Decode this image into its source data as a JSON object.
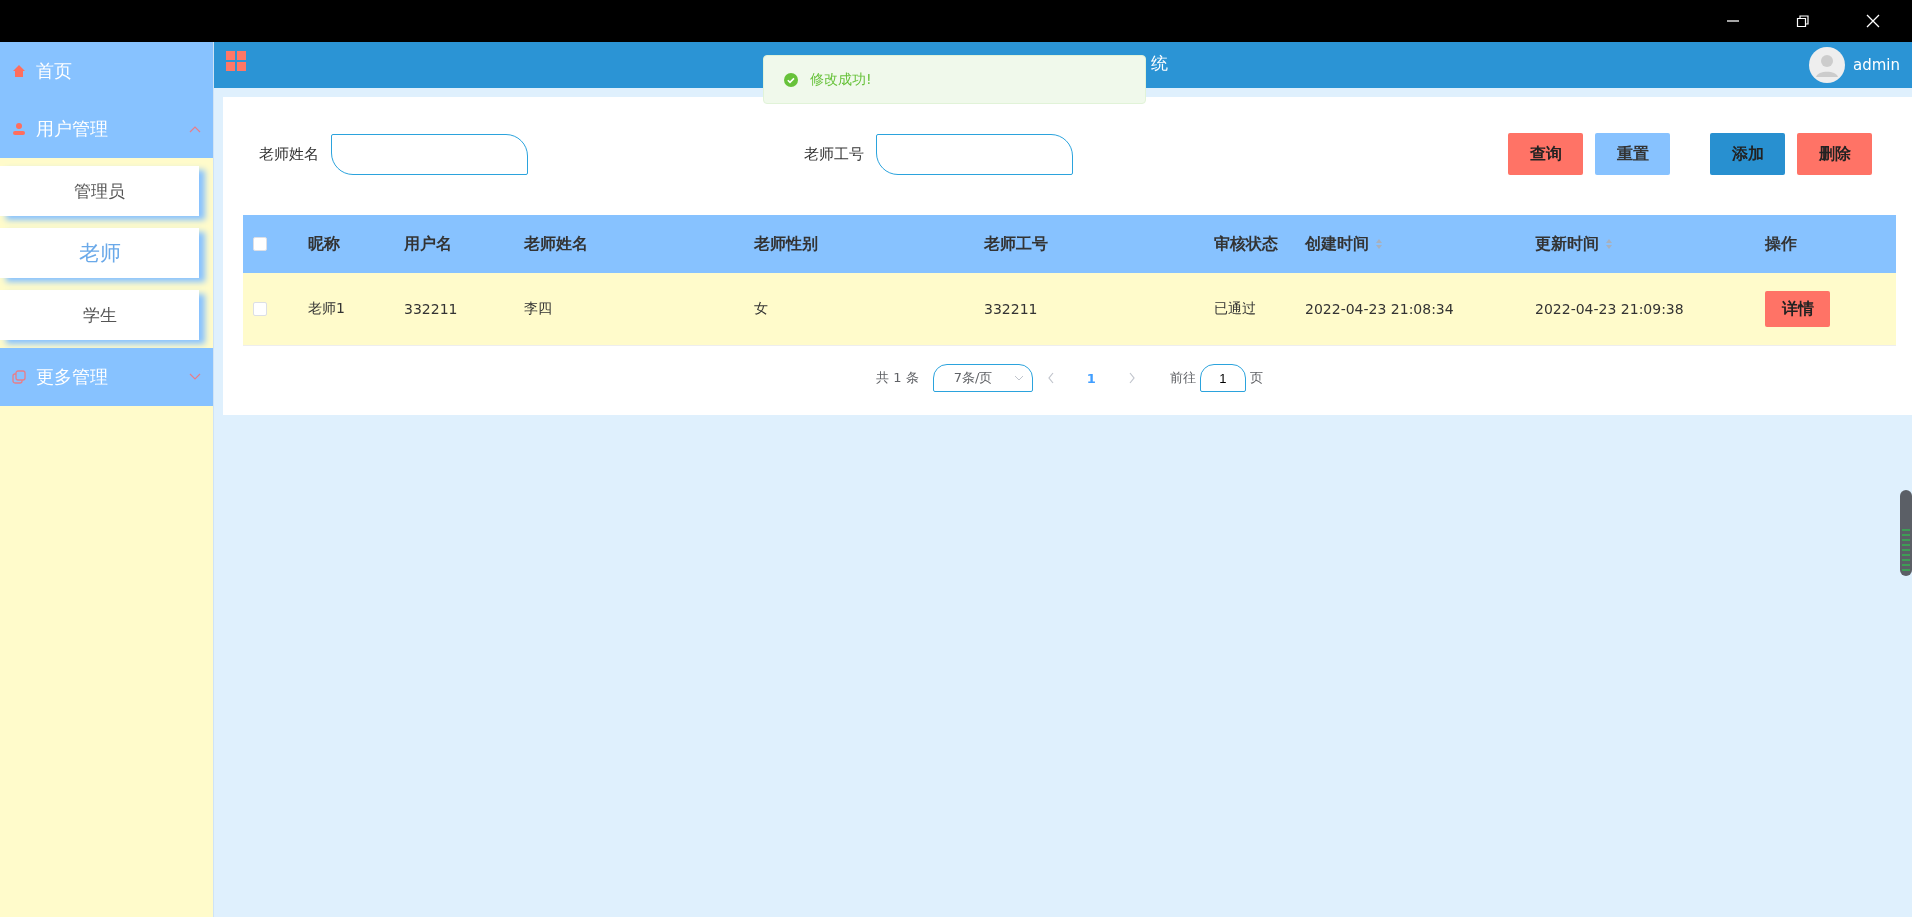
{
  "header": {
    "title": "统",
    "user": "admin"
  },
  "toast": {
    "kind": "success",
    "message": "修改成功!"
  },
  "sidebar": {
    "items": [
      {
        "label": "首页"
      },
      {
        "label": "用户管理",
        "expanded": true,
        "children": [
          {
            "label": "管理员",
            "selected": false
          },
          {
            "label": "老师",
            "selected": true
          },
          {
            "label": "学生",
            "selected": false
          }
        ]
      },
      {
        "label": "更多管理",
        "expanded": false
      }
    ]
  },
  "search": {
    "fields": [
      {
        "label": "老师姓名"
      },
      {
        "label": "老师工号"
      }
    ],
    "buttons": [
      {
        "label": "查询",
        "kind": "danger"
      },
      {
        "label": "重置",
        "kind": "light"
      },
      {
        "label": "添加",
        "kind": "primary"
      },
      {
        "label": "删除",
        "kind": "danger"
      }
    ]
  },
  "table": {
    "select_all": {
      "checked": false
    },
    "columns": [
      {
        "label": "昵称",
        "sortable": false
      },
      {
        "label": "用户名",
        "sortable": false
      },
      {
        "label": "老师姓名",
        "sortable": false
      },
      {
        "label": "老师性别",
        "sortable": false
      },
      {
        "label": "老师工号",
        "sortable": false
      },
      {
        "label": "审核状态",
        "sortable": false
      },
      {
        "label": "创建时间",
        "sortable": true
      },
      {
        "label": "更新时间",
        "sortable": true
      },
      {
        "label": "操作",
        "sortable": false
      }
    ],
    "rows": [
      {
        "checked": false,
        "cells": [
          "老师1",
          "332211",
          "李四",
          "女",
          "332211",
          "已通过",
          "2022-04-23 21:08:34",
          "2022-04-23 21:09:38"
        ],
        "action": "详情"
      }
    ]
  },
  "pagination": {
    "total": "共 1 条",
    "page_size": "7条/页",
    "pages": [
      {
        "label": "1",
        "selected": true
      }
    ],
    "goto_label": "前往",
    "goto_value": "1",
    "goto_suffix": "页"
  }
}
